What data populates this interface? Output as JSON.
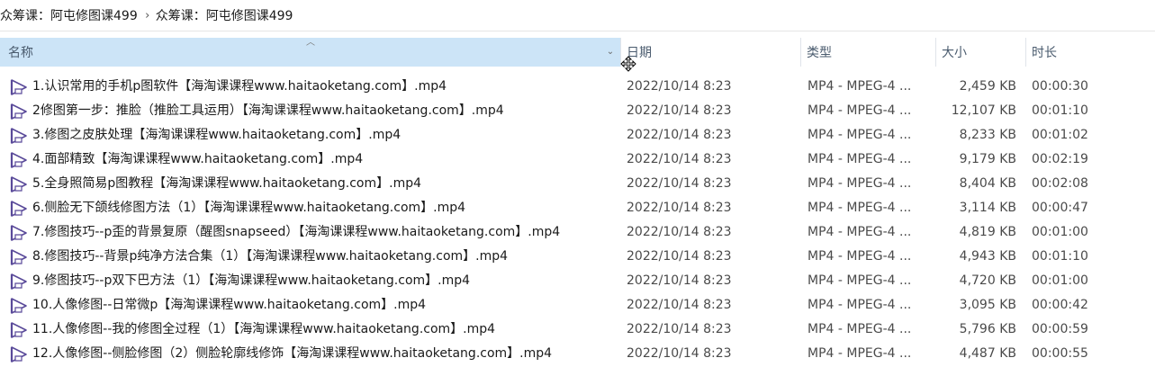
{
  "breadcrumb": {
    "items": [
      "众筹课：阿屯修图课499",
      "众筹课：阿屯修图课499"
    ],
    "separator": "›"
  },
  "columns": {
    "name": "名称",
    "date": "日期",
    "type": "类型",
    "size": "大小",
    "duration": "时长"
  },
  "colors": {
    "selected_header_bg": "#cce4f7",
    "icon_purple": "#5a4a9a"
  },
  "files": [
    {
      "name": "1.认识常用的手机p图软件【海淘课课程www.haitaoketang.com】.mp4",
      "date": "2022/10/14 8:23",
      "type": "MP4 - MPEG-4 ...",
      "size": "2,459 KB",
      "duration": "00:00:30"
    },
    {
      "name": "2修图第一步：推脸（推脸工具运用）【海淘课课程www.haitaoketang.com】.mp4",
      "date": "2022/10/14 8:23",
      "type": "MP4 - MPEG-4 ...",
      "size": "12,107 KB",
      "duration": "00:01:10"
    },
    {
      "name": "3.修图之皮肤处理【海淘课课程www.haitaoketang.com】.mp4",
      "date": "2022/10/14 8:23",
      "type": "MP4 - MPEG-4 ...",
      "size": "8,233 KB",
      "duration": "00:01:02"
    },
    {
      "name": "4.面部精致【海淘课课程www.haitaoketang.com】.mp4",
      "date": "2022/10/14 8:23",
      "type": "MP4 - MPEG-4 ...",
      "size": "9,179 KB",
      "duration": "00:02:19"
    },
    {
      "name": "5.全身照简易p图教程【海淘课课程www.haitaoketang.com】.mp4",
      "date": "2022/10/14 8:23",
      "type": "MP4 - MPEG-4 ...",
      "size": "8,404 KB",
      "duration": "00:02:08"
    },
    {
      "name": "6.侧脸无下颌线修图方法（1）【海淘课课程www.haitaoketang.com】.mp4",
      "date": "2022/10/14 8:23",
      "type": "MP4 - MPEG-4 ...",
      "size": "3,114 KB",
      "duration": "00:00:47"
    },
    {
      "name": "7.修图技巧--p歪的背景复原（醒图snapseed）【海淘课课程www.haitaoketang.com】.mp4",
      "date": "2022/10/14 8:23",
      "type": "MP4 - MPEG-4 ...",
      "size": "4,819 KB",
      "duration": "00:01:00"
    },
    {
      "name": "8.修图技巧--背景p纯净方法合集（1）【海淘课课程www.haitaoketang.com】.mp4",
      "date": "2022/10/14 8:23",
      "type": "MP4 - MPEG-4 ...",
      "size": "4,943 KB",
      "duration": "00:01:10"
    },
    {
      "name": "9.修图技巧--p双下巴方法（1）【海淘课课程www.haitaoketang.com】.mp4",
      "date": "2022/10/14 8:23",
      "type": "MP4 - MPEG-4 ...",
      "size": "4,720 KB",
      "duration": "00:01:00"
    },
    {
      "name": "10.人像修图--日常微p【海淘课课程www.haitaoketang.com】.mp4",
      "date": "2022/10/14 8:23",
      "type": "MP4 - MPEG-4 ...",
      "size": "3,095 KB",
      "duration": "00:00:42"
    },
    {
      "name": "11.人像修图--我的修图全过程（1）【海淘课课程www.haitaoketang.com】.mp4",
      "date": "2022/10/14 8:23",
      "type": "MP4 - MPEG-4 ...",
      "size": "5,796 KB",
      "duration": "00:00:59"
    },
    {
      "name": "12.人像修图--侧脸修图（2）侧脸轮廓线修饰【海淘课课程www.haitaoketang.com】.mp4",
      "date": "2022/10/14 8:23",
      "type": "MP4 - MPEG-4 ...",
      "size": "4,487 KB",
      "duration": "00:00:55"
    }
  ]
}
